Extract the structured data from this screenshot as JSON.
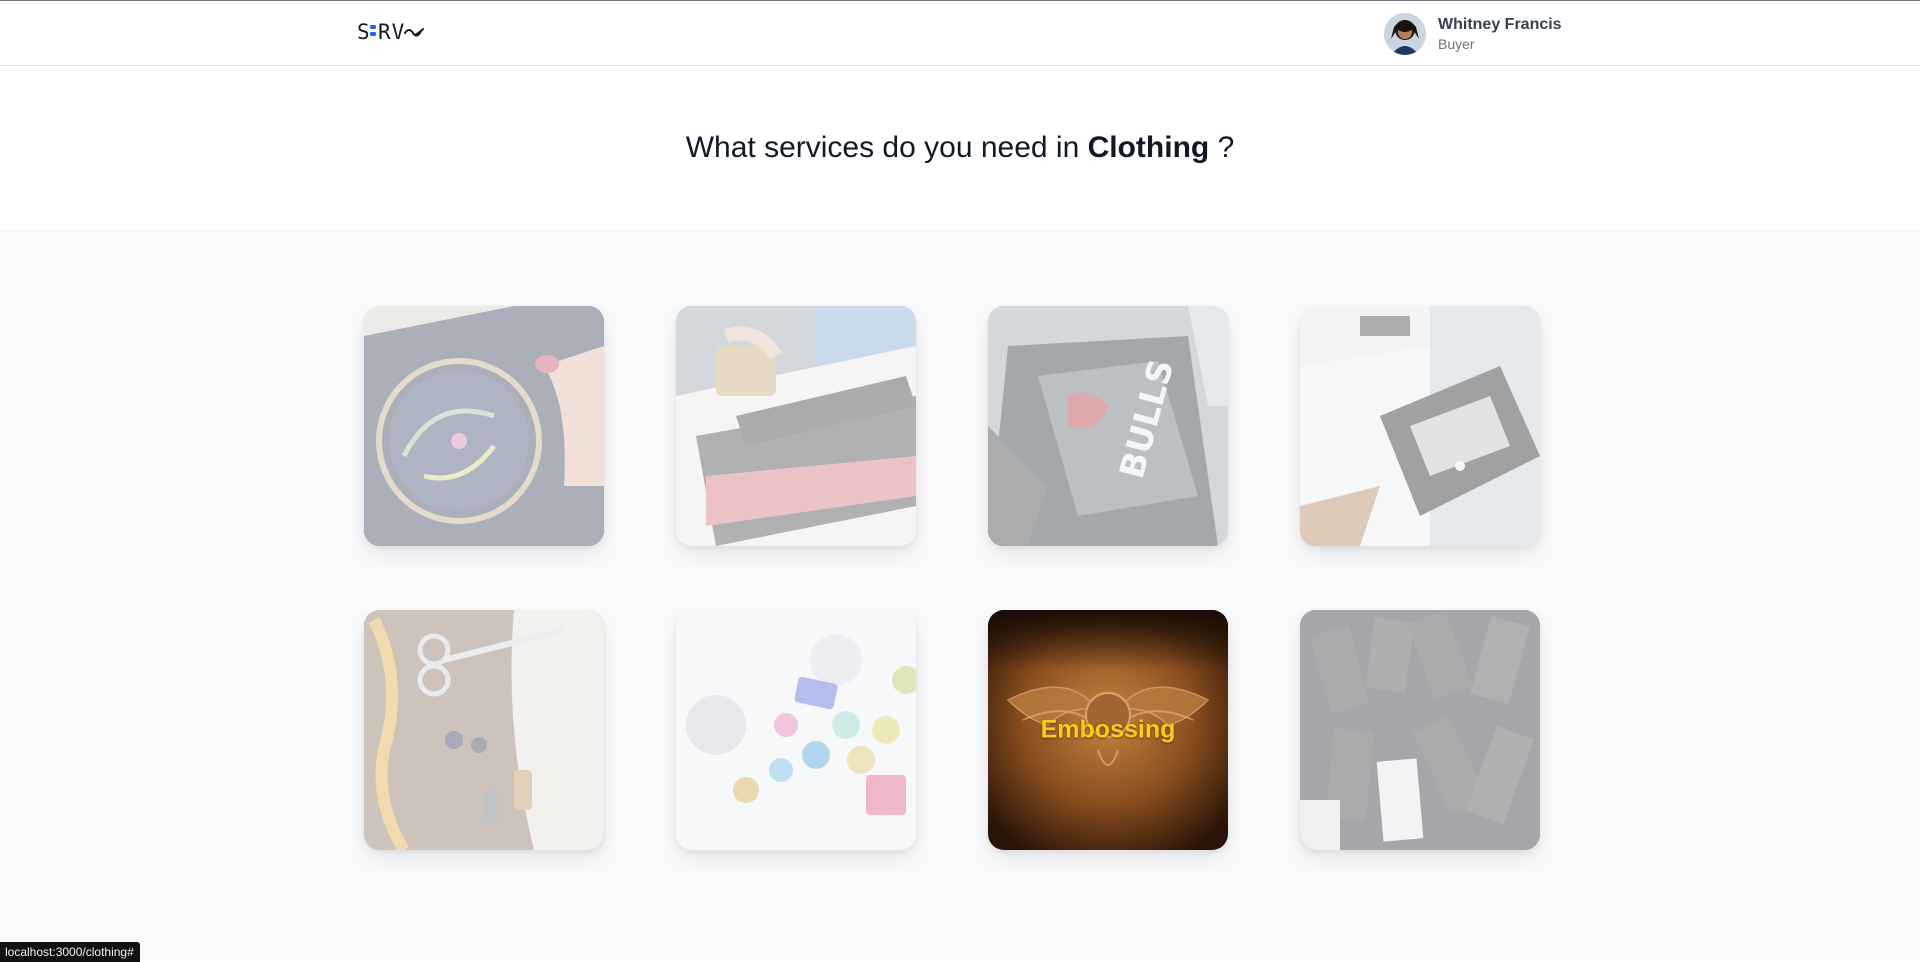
{
  "header": {
    "logo_text": "SERVes",
    "user": {
      "name": "Whitney Francis",
      "role": "Buyer"
    }
  },
  "hero": {
    "question_prefix": "What services do you need in",
    "category": "Clothing",
    "question_suffix": "?"
  },
  "services": [
    {
      "name": "embroidery",
      "label": "",
      "active": false
    },
    {
      "name": "screen-printing",
      "label": "",
      "active": false
    },
    {
      "name": "heat-transfer",
      "label": "",
      "active": false
    },
    {
      "name": "dtg-printing",
      "label": "",
      "active": false
    },
    {
      "name": "tailoring",
      "label": "",
      "active": false
    },
    {
      "name": "rhinestones",
      "label": "",
      "active": false
    },
    {
      "name": "embossing",
      "label": "Embossing",
      "active": true
    },
    {
      "name": "labels",
      "label": "",
      "active": false
    }
  ],
  "status_bar": {
    "url": "localhost:3000/clothing#"
  },
  "colors": {
    "accent": "#facc15",
    "logo_dot": "#2563eb",
    "grid_bg": "#f9fafb"
  }
}
